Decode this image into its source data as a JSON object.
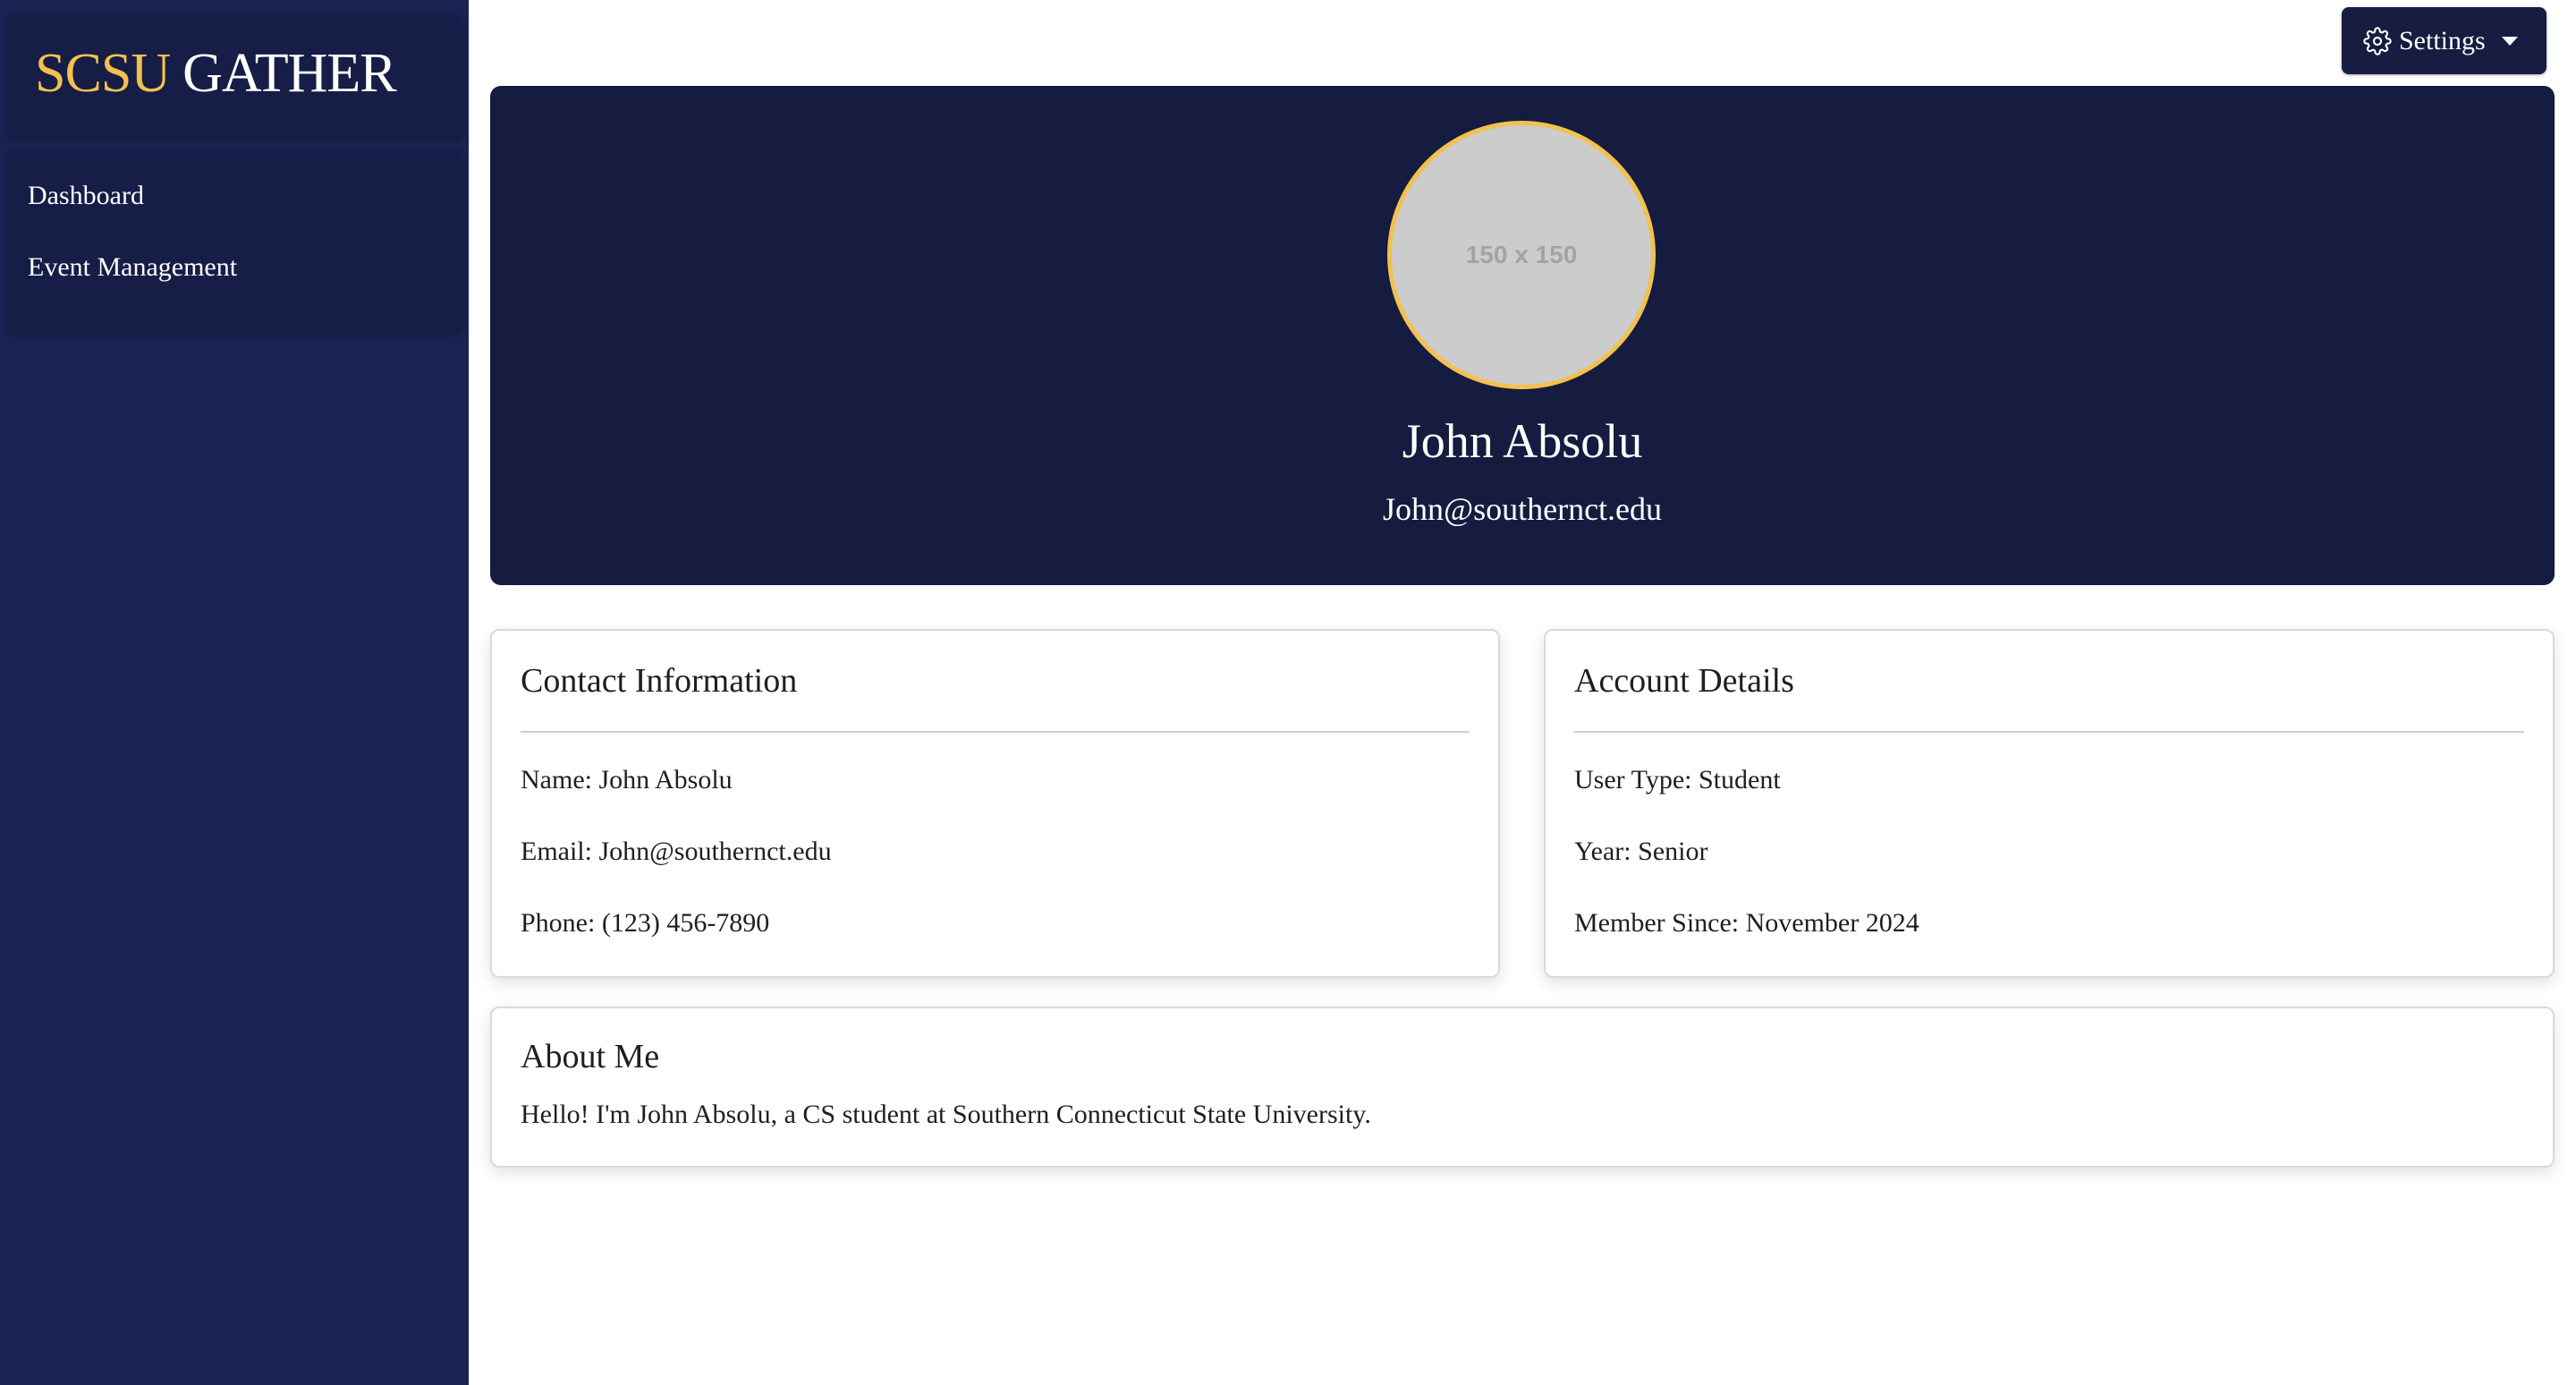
{
  "sidebar": {
    "brand_part1": "SCSU",
    "brand_part2": "GATHER",
    "nav": [
      {
        "label": "Dashboard"
      },
      {
        "label": "Event Management"
      }
    ]
  },
  "header": {
    "settings_label": "Settings"
  },
  "profile": {
    "avatar_placeholder": "150 x 150",
    "name": "John Absolu",
    "email": "John@southernct.edu"
  },
  "contact": {
    "title": "Contact Information",
    "name_line": "Name: John Absolu",
    "email_line": "Email: John@southernct.edu",
    "phone_line": "Phone: (123) 456-7890"
  },
  "account": {
    "title": "Account Details",
    "user_type_line": "User Type: Student",
    "year_line": "Year: Senior",
    "member_since_line": "Member Since: November 2024"
  },
  "about": {
    "title": "About Me",
    "text": "Hello! I'm John Absolu, a CS student at Southern Connecticut State University."
  },
  "colors": {
    "sidebar_bg": "#1b2251",
    "hero_bg": "#151c40",
    "accent_gold": "#f2c14e"
  }
}
